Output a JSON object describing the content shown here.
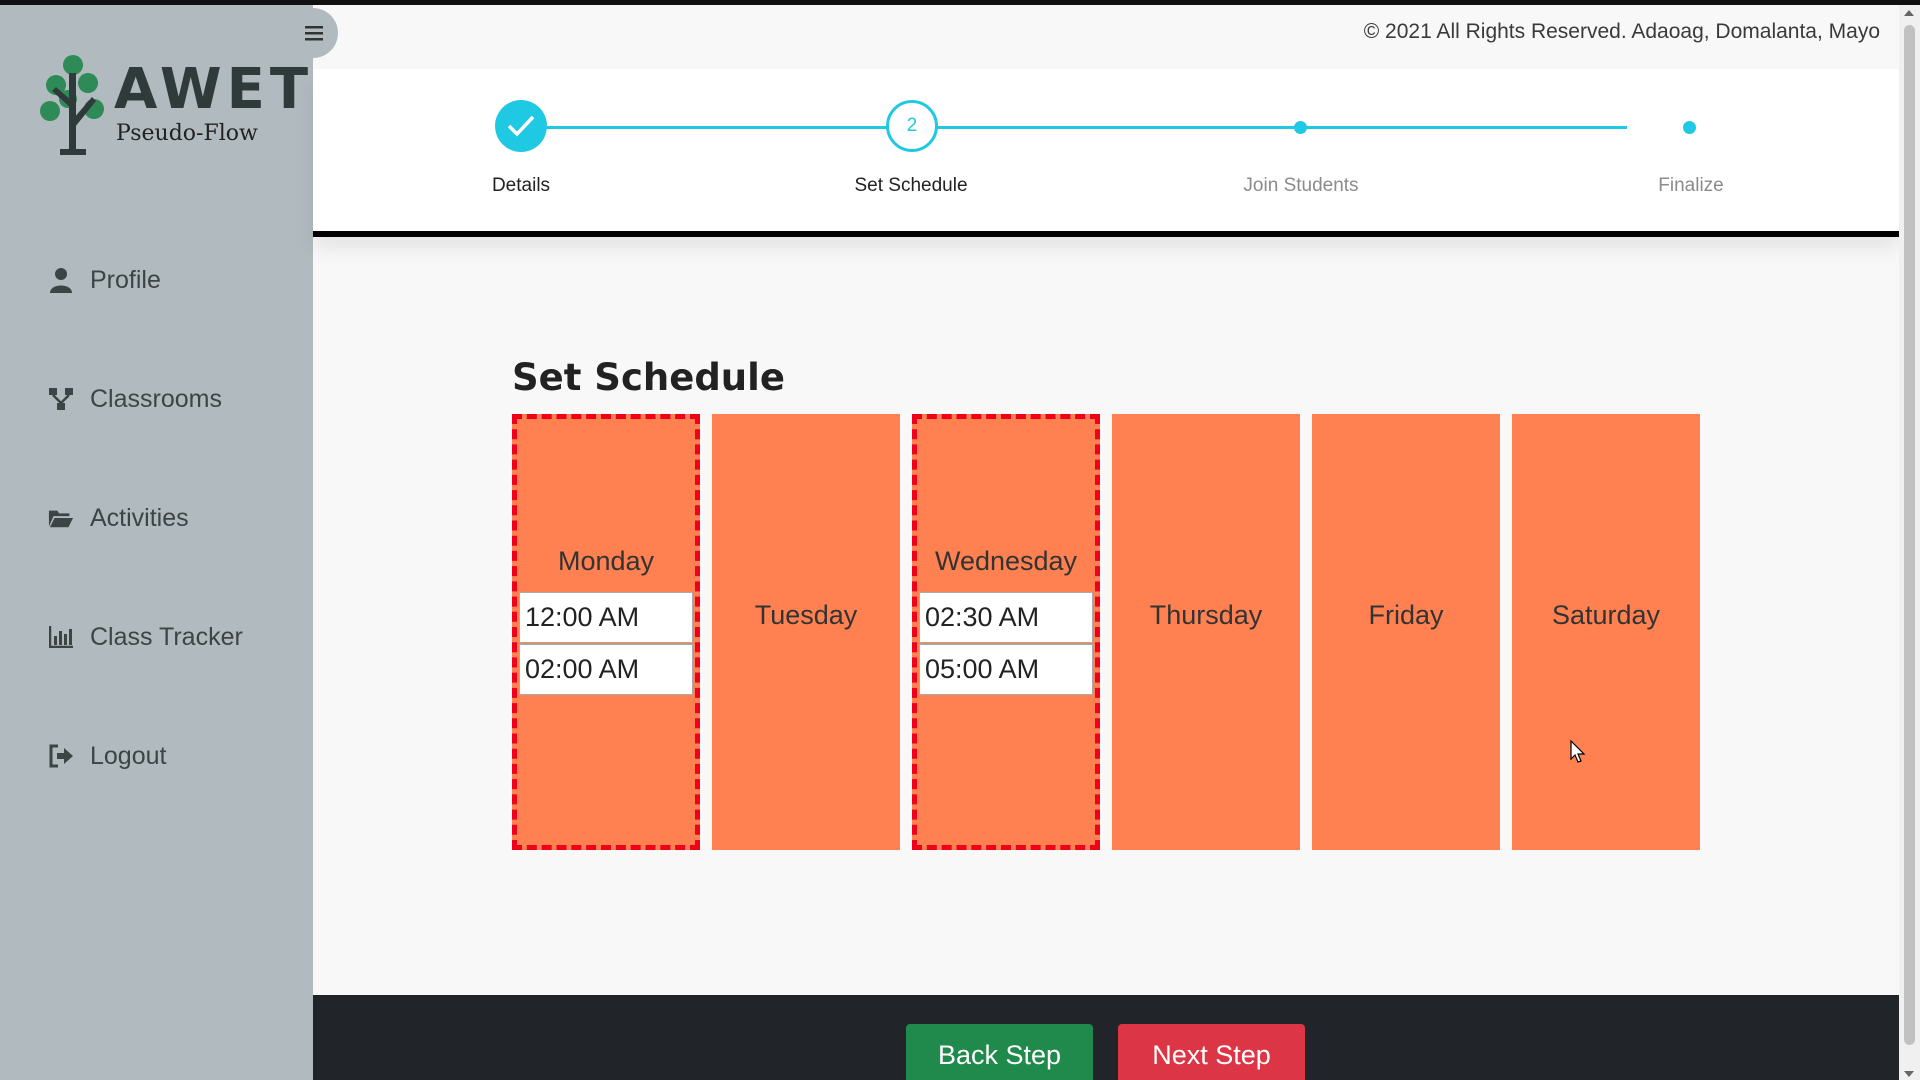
{
  "app": {
    "logo_title": "AWET",
    "logo_subtitle": "Pseudo-Flow",
    "copyright": "© 2021 All Rights Reserved. Adaoag, Domalanta, Mayo"
  },
  "sidebar": {
    "items": [
      {
        "label": "Profile",
        "icon": "user-icon"
      },
      {
        "label": "Classrooms",
        "icon": "network-icon"
      },
      {
        "label": "Activities",
        "icon": "folder-open-icon"
      },
      {
        "label": "Class Tracker",
        "icon": "bar-chart-icon"
      },
      {
        "label": "Logout",
        "icon": "logout-icon"
      }
    ]
  },
  "stepper": {
    "current_step": 2,
    "steps": [
      {
        "label": "Details",
        "state": "done"
      },
      {
        "label": "Set Schedule",
        "state": "current",
        "number": "2"
      },
      {
        "label": "Join Students",
        "state": "upcoming"
      },
      {
        "label": "Finalize",
        "state": "upcoming"
      }
    ]
  },
  "schedule": {
    "title": "Set Schedule",
    "days": [
      {
        "name": "Monday",
        "selected": true,
        "start": "12:00 AM",
        "end": "02:00 AM"
      },
      {
        "name": "Tuesday",
        "selected": false
      },
      {
        "name": "Wednesday",
        "selected": true,
        "start": "02:30 AM",
        "end": "05:00 AM"
      },
      {
        "name": "Thursday",
        "selected": false
      },
      {
        "name": "Friday",
        "selected": false
      },
      {
        "name": "Saturday",
        "selected": false
      }
    ]
  },
  "footer": {
    "back_label": "Back Step",
    "next_label": "Next Step"
  },
  "colors": {
    "sidebar_bg": "#b1bbbf",
    "accent": "#1fc8e3",
    "day_bg": "#ff8151",
    "selected_border": "#f00019",
    "back_button": "#1f8a4c",
    "next_button": "#dc3545",
    "footer_bg": "#212529"
  }
}
